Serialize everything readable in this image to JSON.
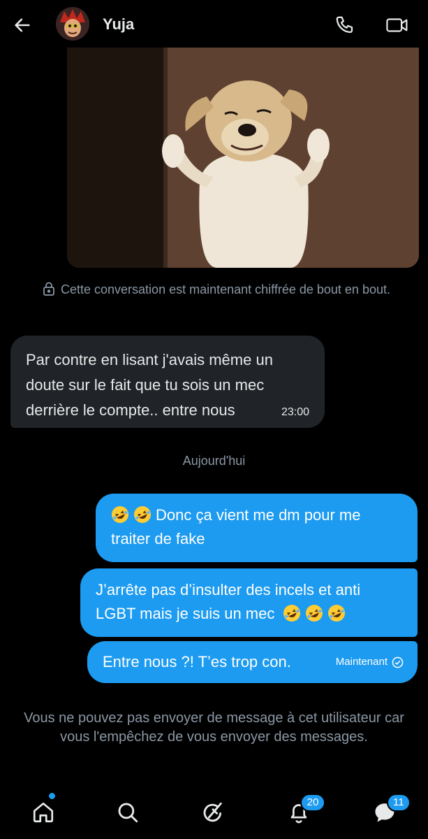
{
  "header": {
    "back_icon": "arrow-left-icon",
    "contact_name": "Yuja",
    "call_icon": "phone-icon",
    "video_icon": "video-camera-icon"
  },
  "messages": {
    "image_alt": "Dog standing with raised paws",
    "encryption_notice": "Cette conversation est maintenant chiffrée de bout en bout.",
    "incoming": {
      "text": "Par contre en lisant j'avais même un doute sur le fait que tu sois un mec derrière le compte.. entre nous",
      "time": "23:00"
    },
    "day_separator": "Aujourd'hui",
    "outgoing": [
      {
        "emojis_before": 2,
        "text": "Donc ça vient me dm pour me traiter de fake"
      },
      {
        "text": "J’arrête pas d’insulter des incels et anti LGBT mais je suis un mec",
        "emojis_after": 3
      },
      {
        "text": "Entre nous ?! T’es trop con.",
        "time": "Maintenant",
        "status_icon": "sent-check-icon"
      }
    ],
    "blocked_notice": "Vous ne pouvez pas envoyer de message à cet utilisateur car vous l'empêchez de vous envoyer des messages."
  },
  "bottom_nav": {
    "items": [
      {
        "icon": "home-icon"
      },
      {
        "icon": "search-icon"
      },
      {
        "icon": "grok-icon"
      },
      {
        "icon": "bell-icon",
        "badge": "20"
      },
      {
        "icon": "messages-icon",
        "badge": "11"
      }
    ]
  },
  "colors": {
    "background": "#000000",
    "accent": "#1d9bf0",
    "incoming_bubble": "#202327",
    "muted_text": "#8b98a5"
  }
}
